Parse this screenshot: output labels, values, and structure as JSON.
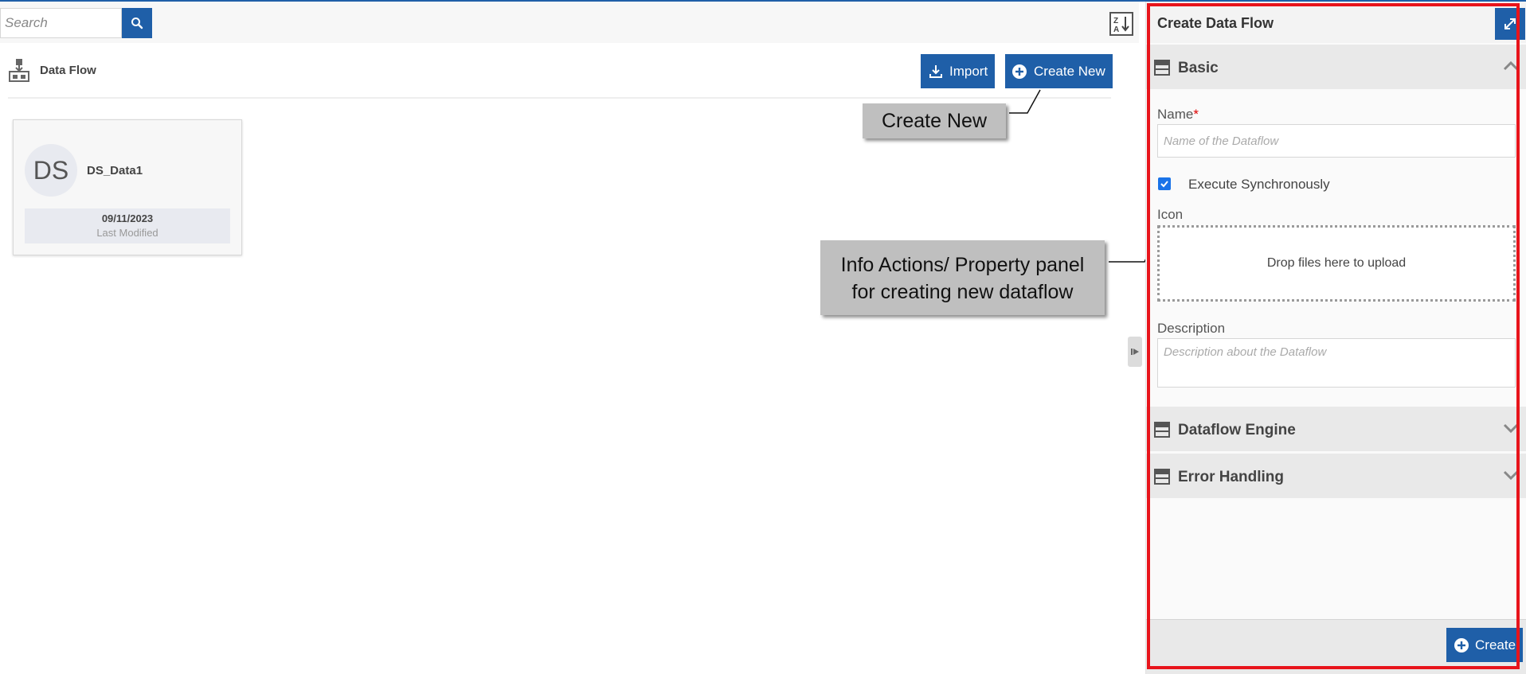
{
  "search": {
    "placeholder": "Search"
  },
  "header": {
    "title": "Data Flow",
    "import_label": "Import",
    "create_new_label": "Create New"
  },
  "cards": [
    {
      "initials": "DS",
      "name": "DS_Data1",
      "date": "09/11/2023",
      "date_label": "Last Modified"
    }
  ],
  "callouts": {
    "create_new": "Create New",
    "info_line1": "Info Actions/ Property panel",
    "info_line2": "for creating new dataflow"
  },
  "panel": {
    "title": "Create Data Flow",
    "sections": {
      "basic": "Basic",
      "engine": "Dataflow Engine",
      "error": "Error Handling"
    },
    "name_label": "Name",
    "name_required": "*",
    "name_placeholder": "Name of the Dataflow",
    "execute_sync_label": "Execute Synchronously",
    "execute_sync_checked": true,
    "icon_label": "Icon",
    "dropzone_text": "Drop files here to upload",
    "description_label": "Description",
    "description_placeholder": "Description about the Dataflow",
    "create_button": "Create"
  },
  "colors": {
    "accent": "#1f5fa8",
    "highlight_frame": "#e8141b",
    "callout_bg": "#bfbfbf",
    "checkbox": "#1a73e8"
  },
  "icons": [
    "search-icon",
    "sort-az-icon",
    "dataflow-icon",
    "import-icon",
    "plus-circle-icon",
    "expand-icon",
    "section-icon",
    "chevron-up-icon",
    "chevron-down-icon",
    "collapse-panel-icon",
    "checkmark-icon"
  ]
}
